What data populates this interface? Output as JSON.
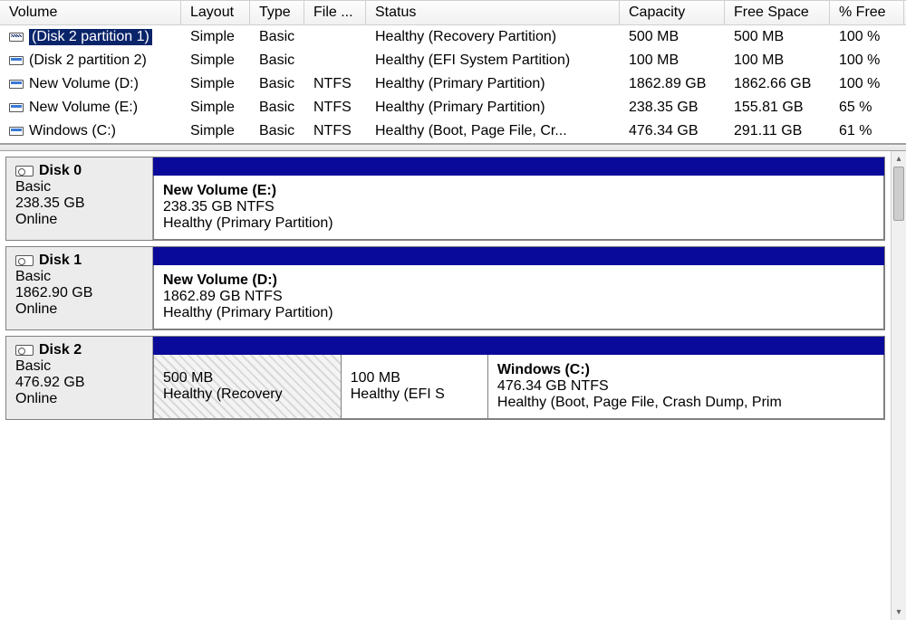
{
  "columns": {
    "volume": "Volume",
    "layout": "Layout",
    "type": "Type",
    "fs": "File ...",
    "status": "Status",
    "capacity": "Capacity",
    "free": "Free Space",
    "pct": "% Free"
  },
  "volumes": [
    {
      "name": "(Disk 2 partition 1)",
      "layout": "Simple",
      "type": "Basic",
      "fs": "",
      "status": "Healthy (Recovery Partition)",
      "capacity": "500 MB",
      "free": "500 MB",
      "pct": "100 %",
      "selected": true
    },
    {
      "name": "(Disk 2 partition 2)",
      "layout": "Simple",
      "type": "Basic",
      "fs": "",
      "status": "Healthy (EFI System Partition)",
      "capacity": "100 MB",
      "free": "100 MB",
      "pct": "100 %",
      "selected": false
    },
    {
      "name": "New Volume (D:)",
      "layout": "Simple",
      "type": "Basic",
      "fs": "NTFS",
      "status": "Healthy (Primary Partition)",
      "capacity": "1862.89 GB",
      "free": "1862.66 GB",
      "pct": "100 %",
      "selected": false
    },
    {
      "name": "New Volume (E:)",
      "layout": "Simple",
      "type": "Basic",
      "fs": "NTFS",
      "status": "Healthy (Primary Partition)",
      "capacity": "238.35 GB",
      "free": "155.81 GB",
      "pct": "65 %",
      "selected": false
    },
    {
      "name": "Windows (C:)",
      "layout": "Simple",
      "type": "Basic",
      "fs": "NTFS",
      "status": "Healthy (Boot, Page File, Cr...",
      "capacity": "476.34 GB",
      "free": "291.11 GB",
      "pct": "61 %",
      "selected": false
    }
  ],
  "disks": [
    {
      "name": "Disk 0",
      "type": "Basic",
      "size": "238.35 GB",
      "state": "Online",
      "partitions": [
        {
          "title": "New Volume  (E:)",
          "info": "238.35 GB NTFS",
          "status": "Healthy (Primary Partition)",
          "flex": 1,
          "hatched": false
        }
      ]
    },
    {
      "name": "Disk 1",
      "type": "Basic",
      "size": "1862.90 GB",
      "state": "Online",
      "partitions": [
        {
          "title": "New Volume  (D:)",
          "info": "1862.89 GB NTFS",
          "status": "Healthy (Primary Partition)",
          "flex": 1,
          "hatched": false
        }
      ]
    },
    {
      "name": "Disk 2",
      "type": "Basic",
      "size": "476.92 GB",
      "state": "Online",
      "partitions": [
        {
          "title": "",
          "info": "500 MB",
          "status": "Healthy (Recovery",
          "flex": 0.25,
          "hatched": true
        },
        {
          "title": "",
          "info": "100 MB",
          "status": "Healthy (EFI S",
          "flex": 0.19,
          "hatched": false
        },
        {
          "title": "Windows  (C:)",
          "info": "476.34 GB NTFS",
          "status": "Healthy (Boot, Page File, Crash Dump, Prim",
          "flex": 0.56,
          "hatched": false
        }
      ]
    }
  ]
}
